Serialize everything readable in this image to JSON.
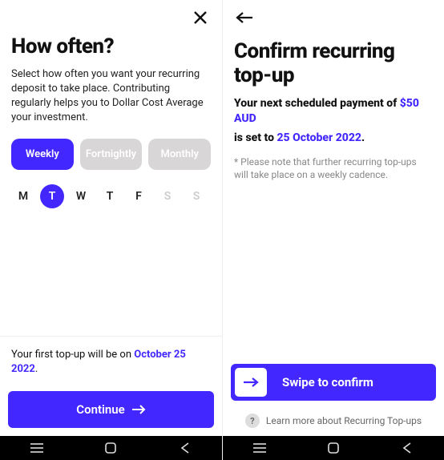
{
  "left": {
    "title": "How often?",
    "description": "Select how often you want your recurring deposit to take place. Contributing regularly helps you to Dollar Cost Average your investment.",
    "frequencies": [
      {
        "label": "Weekly",
        "active": true
      },
      {
        "label": "Fortnightly",
        "active": false
      },
      {
        "label": "Monthly",
        "active": false
      }
    ],
    "days": [
      {
        "label": "M",
        "state": "normal"
      },
      {
        "label": "T",
        "state": "selected"
      },
      {
        "label": "W",
        "state": "normal"
      },
      {
        "label": "T",
        "state": "normal"
      },
      {
        "label": "F",
        "state": "normal"
      },
      {
        "label": "S",
        "state": "disabled"
      },
      {
        "label": "S",
        "state": "disabled"
      }
    ],
    "first_topup_prefix": "Your first top-up will be on ",
    "first_topup_date": "October 25 2022",
    "first_topup_suffix": ".",
    "continue_label": "Continue"
  },
  "right": {
    "title": "Confirm recurring top-up",
    "next_payment_prefix": "Your next scheduled payment of ",
    "next_payment_amount": "$50 AUD",
    "set_prefix": "is set to ",
    "set_date": "25 October 2022",
    "set_suffix": ".",
    "note": "* Please note that further recurring top-ups will take place on a weekly cadence.",
    "swipe_label": "Swipe to confirm",
    "learn_more": "Learn more about Recurring Top-ups"
  },
  "icons": {
    "close": "close-icon",
    "back": "back-arrow-icon",
    "arrow_right": "arrow-right-icon",
    "question": "?"
  },
  "colors": {
    "accent": "#4227ff"
  }
}
